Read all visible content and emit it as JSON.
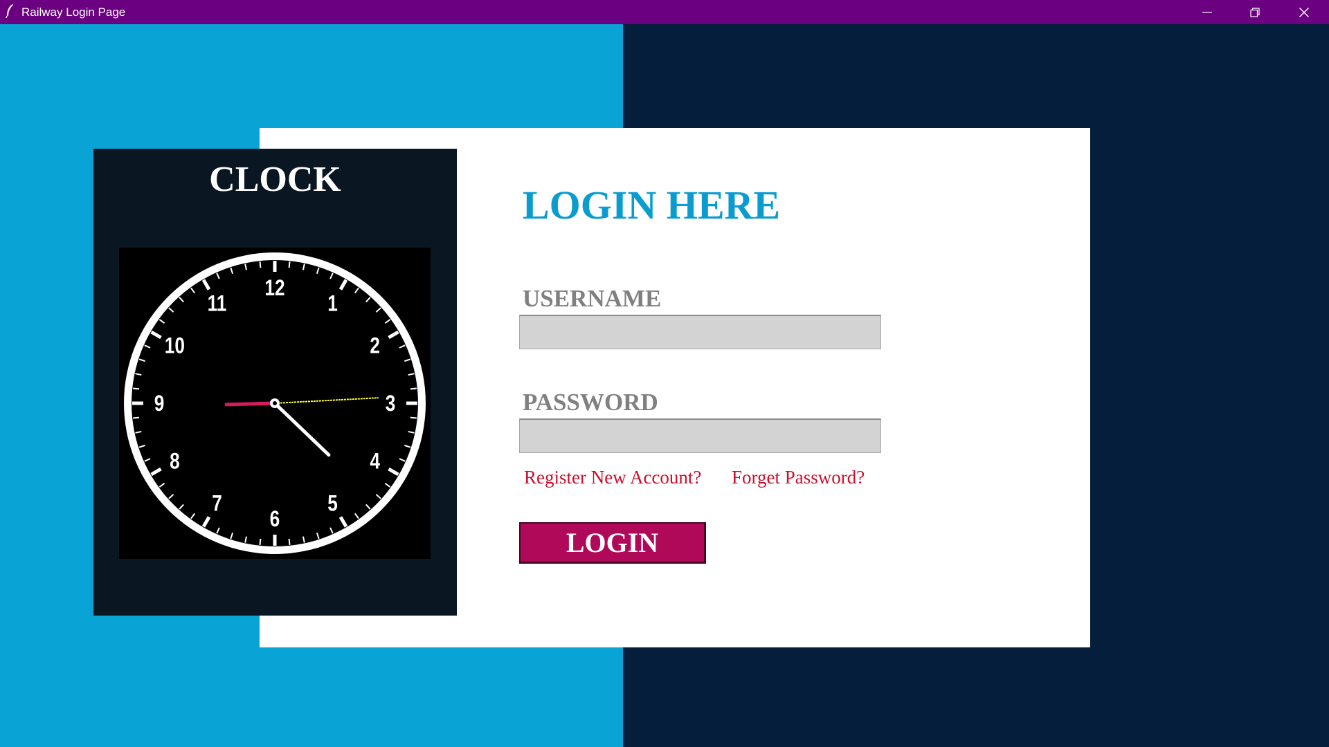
{
  "window": {
    "title": "Railway Login Page",
    "colors": {
      "titlebar": "#6b0080"
    },
    "controls": [
      "minimize-icon",
      "restore-icon",
      "close-icon"
    ]
  },
  "background": {
    "left_color": "#09a3d5",
    "right_color": "#041e3b"
  },
  "clock": {
    "title": "CLOCK",
    "numerals": [
      "12",
      "1",
      "2",
      "3",
      "4",
      "5",
      "6",
      "7",
      "8",
      "9",
      "10",
      "11"
    ],
    "time": {
      "hour": 8.95,
      "minute": 22.3,
      "second": 14.5
    },
    "colors": {
      "hour_hand": "#d81b60",
      "minute_hand": "#ffffff",
      "second_hand": "#ffff33",
      "ring": "#ffffff"
    }
  },
  "login": {
    "heading": "LOGIN HERE",
    "username": {
      "label": "USERNAME",
      "value": "",
      "placeholder": ""
    },
    "password": {
      "label": "PASSWORD",
      "value": "",
      "placeholder": ""
    },
    "register_link": "Register New Account?",
    "forgot_link": "Forget Password?",
    "submit_label": "LOGIN",
    "colors": {
      "heading": "#0b9ccf",
      "button": "#b0095a",
      "link": "#c8102e"
    }
  }
}
